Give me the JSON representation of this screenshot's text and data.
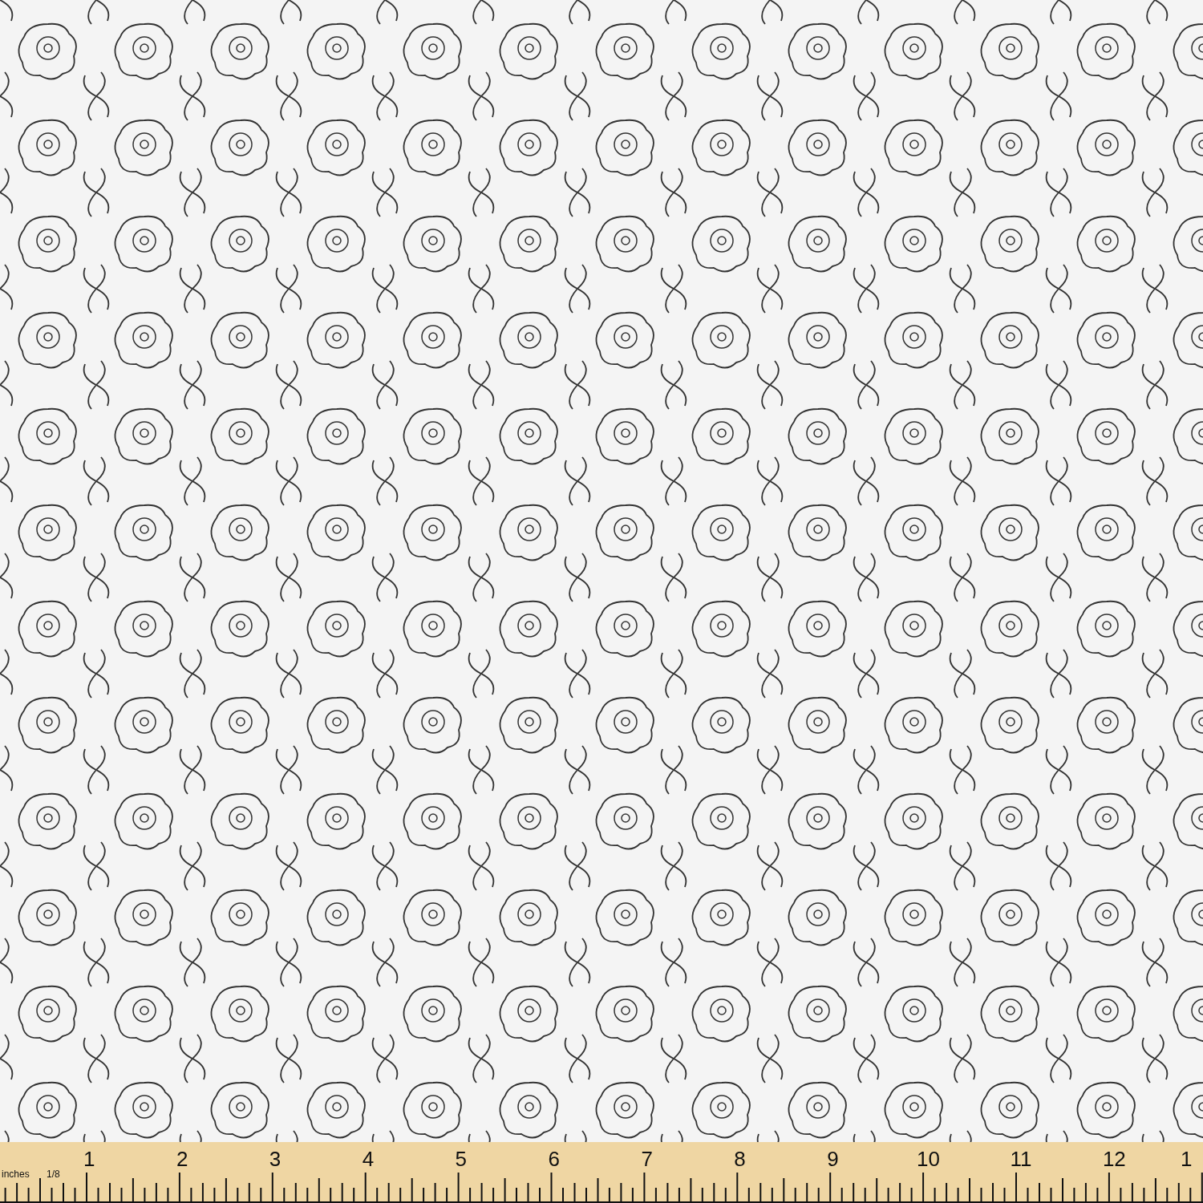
{
  "fabric": {
    "kind": "photo"
  },
  "ruler": {
    "unit_label": "inches",
    "fraction_label": "1/8",
    "numbers": [
      "1",
      "2",
      "3",
      "4",
      "5",
      "6",
      "7",
      "8",
      "9",
      "10",
      "11",
      "12",
      "1"
    ]
  }
}
